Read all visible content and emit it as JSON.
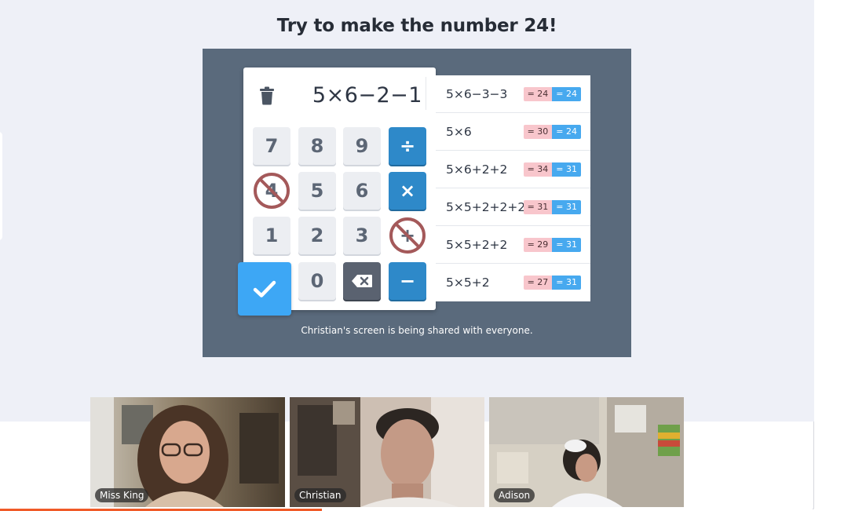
{
  "title": "Try to make the number 24!",
  "display": {
    "expression": "5×6−2−1"
  },
  "keypad": {
    "row1": [
      "7",
      "8",
      "9",
      "÷"
    ],
    "row2": [
      "4",
      "5",
      "6",
      "×"
    ],
    "row3": [
      "1",
      "2",
      "3",
      "+"
    ],
    "row4": [
      "0",
      "−"
    ],
    "disabled": [
      "4",
      "+"
    ]
  },
  "history": [
    {
      "expr": "5×6−3−3",
      "result": "= 24",
      "target": "= 24"
    },
    {
      "expr": "5×6",
      "result": "= 30",
      "target": "= 24"
    },
    {
      "expr": "5×6+2+2",
      "result": "= 34",
      "target": "= 31"
    },
    {
      "expr": "5×5+2+2+2",
      "result": "= 31",
      "target": "= 31"
    },
    {
      "expr": "5×5+2+2",
      "result": "= 29",
      "target": "= 31"
    },
    {
      "expr": "5×5+2",
      "result": "= 27",
      "target": "= 31"
    }
  ],
  "share_notice": "Christian's screen is being shared with everyone.",
  "participants": [
    {
      "name": "Miss King"
    },
    {
      "name": "Christian"
    },
    {
      "name": "Adison"
    }
  ],
  "colors": {
    "operator_key": "#2e89c9",
    "submit_key": "#3da7f5",
    "result_badge": "#f8c6cc",
    "target_badge": "#47a9ef",
    "share_panel": "#5a6a7c",
    "progress": "#f05a28"
  },
  "icons": {
    "trash": "trash-icon",
    "submit": "checkmark-icon",
    "backspace": "backspace-icon",
    "forbidden": "prohibited-icon"
  }
}
